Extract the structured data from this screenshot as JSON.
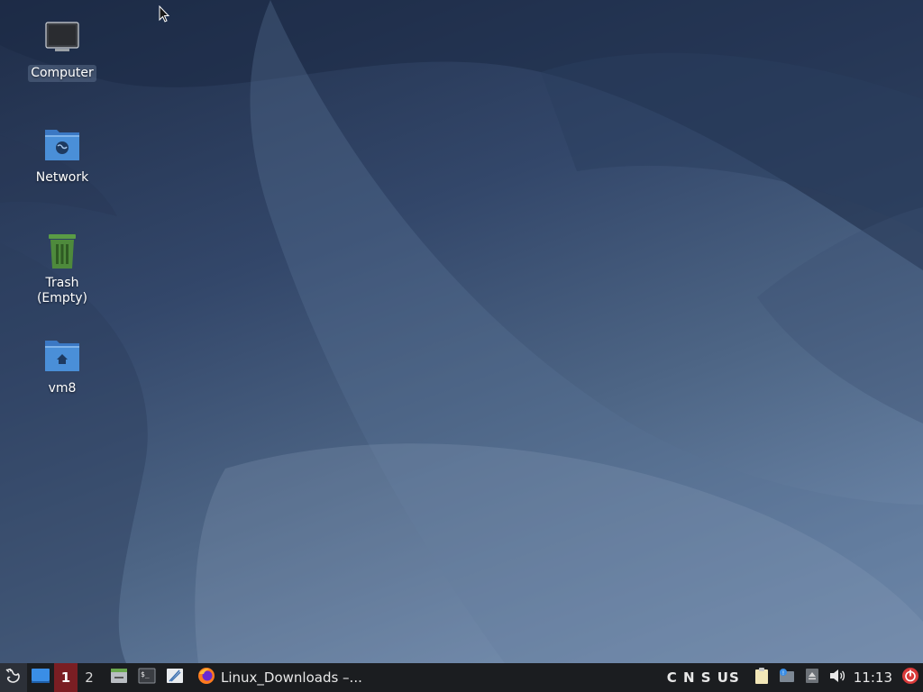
{
  "desktop": {
    "icons": [
      {
        "label": "Computer",
        "icon": "computer-icon"
      },
      {
        "label": "Network",
        "icon": "network-folder-icon"
      },
      {
        "label": "Trash\n(Empty)",
        "icon": "trash-icon"
      },
      {
        "label": "vm8",
        "icon": "home-folder-icon"
      }
    ]
  },
  "taskbar": {
    "menu_icon": "xfce-mouse-icon",
    "show_desktop_icon": "show-desktop-icon",
    "workspaces": [
      "1",
      "2"
    ],
    "active_workspace": "1",
    "launchers": [
      {
        "icon": "file-manager-icon"
      },
      {
        "icon": "terminal-icon"
      },
      {
        "icon": "text-editor-icon"
      }
    ],
    "tasks": [
      {
        "label": "Linux_Downloads –...",
        "icon": "firefox-icon"
      }
    ],
    "tray": {
      "keyboard_indicators": "C N S US",
      "icons": [
        "clipboard-icon",
        "notification-icon",
        "eject-icon",
        "volume-icon"
      ],
      "clock": "11:13",
      "power_icon": "power-icon"
    }
  },
  "colors": {
    "taskbar_bg": "#1b1d20",
    "active_workspace": "#7a1e23",
    "power_red": "#d93a3a",
    "folder_blue": "#4a8fd8",
    "trash_green": "#4e8a3c"
  }
}
